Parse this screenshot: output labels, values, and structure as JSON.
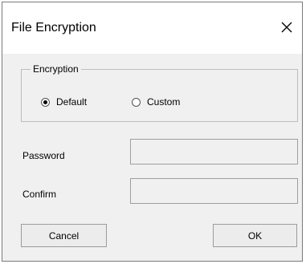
{
  "window": {
    "title": "File Encryption",
    "close_icon": "close-icon"
  },
  "encryption": {
    "legend": "Encryption",
    "options": [
      {
        "label": "Default",
        "selected": true
      },
      {
        "label": "Custom",
        "selected": false
      }
    ]
  },
  "fields": {
    "password": {
      "label": "Password",
      "value": ""
    },
    "confirm": {
      "label": "Confirm",
      "value": ""
    }
  },
  "buttons": {
    "cancel": "Cancel",
    "ok": "OK"
  }
}
